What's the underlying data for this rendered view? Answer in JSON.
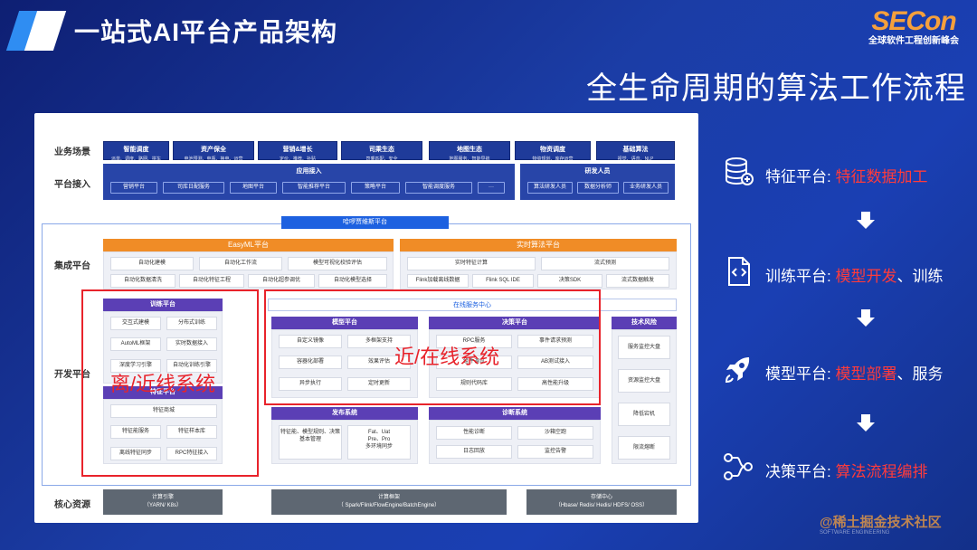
{
  "slide": {
    "title": "一站式AI平台产品架构",
    "headline": "全生命周期的算法工作流程",
    "brand": {
      "word": "SECon",
      "subtitle": "全球软件工程创新峰会"
    },
    "watermark": {
      "text": "@稀土掘金技术社区",
      "sub": "SOFTWARE ENGINEERING"
    }
  },
  "diagram": {
    "row_labels": {
      "business": "业务场景",
      "access": "平台接入",
      "integration": "集成平台",
      "development": "开发平台",
      "core": "核心资源"
    },
    "business": [
      {
        "title": "智能调度",
        "sub": "派单、调度、路网、拼车"
      },
      {
        "title": "资产保全",
        "sub": "电池预测、电瓶、换电、运营"
      },
      {
        "title": "营销&增长",
        "sub": "定价、推荐、补贴"
      },
      {
        "title": "司乘生态",
        "sub": "司乘匹配、安全"
      },
      {
        "title": "地图生态",
        "sub": "地图服务、智能导航"
      },
      {
        "title": "物资调度",
        "sub": "物资规划、库存运营"
      },
      {
        "title": "基础算法",
        "sub": "视觉、语音、NLP"
      }
    ],
    "app_access": {
      "title": "应用接入",
      "items": [
        "营销平台",
        "司库日配服务",
        "地图平台",
        "智能推荐平台",
        "策略平台",
        "智能调度服务",
        "···"
      ]
    },
    "dev_access": {
      "title": "研发人员",
      "items": [
        "算法研发人员",
        "数据分析师",
        "业务研发人员"
      ]
    },
    "hello": "哈啰贾维斯平台",
    "easyml": {
      "title": "EasyML平台",
      "items": [
        "自动化建模",
        "自动化工作流",
        "模型可视化校验评估",
        "自动化数据清洗",
        "自动化特征工程",
        "自动化超参调优",
        "自动化模型选择"
      ]
    },
    "realtime": {
      "title": "实时算法平台",
      "items": [
        "实时特征计算",
        "流式预测",
        "Flink加载离线数据",
        "Flink SQL IDE",
        "决策SDK",
        "流式数据触发"
      ]
    },
    "online_center": "在线服务中心",
    "training": {
      "title": "训练平台",
      "items": [
        "交互式建模",
        "分布式训练",
        "AutoML框架",
        "实时数据接入",
        "深度学习引擎",
        "自动化训练引擎"
      ]
    },
    "feature": {
      "title": "特征平台",
      "items": [
        "特征商城",
        "特征能服务",
        "特征样本库",
        "离线特征同步",
        "RPC特征接入"
      ]
    },
    "model": {
      "title": "模型平台",
      "items": [
        "自定义镜像",
        "多框架支持",
        "容器化部署",
        "效果评估",
        "异步执行",
        "定时更新"
      ]
    },
    "decision": {
      "title": "决策平台",
      "items": [
        "RPC服务",
        "事件请求预测",
        "组件调试",
        "AB测试接入",
        "规则代码库",
        "高性能升级"
      ]
    },
    "tech_risk": {
      "title": "技术风险",
      "items": [
        "服务监控大盘",
        "资源监控大盘",
        "降低宕机",
        "限流熔断"
      ]
    },
    "release": {
      "title": "发布系统",
      "items": [
        "特征能、模型规则、决策基本管理",
        "Fat、Uat\nPre、Pro\n多环境同步"
      ]
    },
    "diagnose": {
      "title": "诊断系统",
      "items": [
        "性能诊断",
        "沙箱空跑",
        "日志回放",
        "监控告警"
      ]
    },
    "core": [
      {
        "title": "计算引擎",
        "sub": "（YARN/ K8s）"
      },
      {
        "title": "计算框架",
        "sub": "（ Spark/Flink/FlowEngine/BatchEngine）"
      },
      {
        "title": "存储中心",
        "sub": "（Hbase/ Redis/ Hedis/ HDFS/ OSS）"
      }
    ],
    "overlay_offline": "离/近线系统",
    "overlay_online": "近/在线系统"
  },
  "sidebar": [
    {
      "icon": "database-icon",
      "prefix": "特征平台: ",
      "highlight": "特征数据加工",
      "suffix": ""
    },
    {
      "icon": "code-file-icon",
      "prefix": "训练平台: ",
      "highlight": "模型开发",
      "suffix": "、训练"
    },
    {
      "icon": "rocket-icon",
      "prefix": "模型平台: ",
      "highlight": "模型部署",
      "suffix": "、服务"
    },
    {
      "icon": "workflow-icon",
      "prefix": "决策平台: ",
      "highlight": "算法流程编排",
      "suffix": ""
    }
  ]
}
